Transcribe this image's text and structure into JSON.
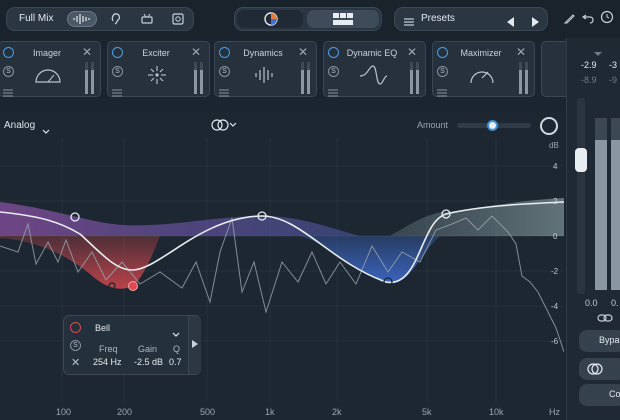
{
  "topbar": {
    "mix_label": "Full Mix",
    "presets_label": "Presets"
  },
  "modules": [
    {
      "name": "Imager",
      "icon": "imager-icon"
    },
    {
      "name": "Exciter",
      "icon": "exciter-icon"
    },
    {
      "name": "Dynamics",
      "icon": "dynamics-icon"
    },
    {
      "name": "Dynamic EQ",
      "icon": "dynamic-eq-icon"
    },
    {
      "name": "Maximizer",
      "icon": "maximizer-icon"
    }
  ],
  "module_solo_glyph": "S",
  "module_close_glyph": "✕",
  "eq": {
    "mode_label": "Analog",
    "amount_label": "Amount",
    "amount_value": 0.49,
    "db_label": "dB",
    "db_scale": [
      "4",
      "2",
      "0",
      "-2",
      "-4",
      "-6"
    ],
    "freq_ticks": [
      "100",
      "200",
      "500",
      "1k",
      "2k",
      "5k",
      "10k",
      "Hz"
    ]
  },
  "band": {
    "type": "Bell",
    "freq_label": "Freq",
    "gain_label": "Gain",
    "q_label": "Q",
    "freq_value": "254 Hz",
    "gain_value": "-2.5 dB",
    "q_value": "0.7"
  },
  "right_panel": {
    "peak_left": "-2.9",
    "peak_right": "-3",
    "rms_left": "-8.9",
    "rms_right": "-9",
    "bottom_left": "0.0",
    "bottom_right": "0.",
    "bypass_label": "Bypa",
    "compare_label": "Co"
  },
  "colors": {
    "accent": "#3f8ed4",
    "cut": "#e0494f",
    "boost_purple": "#7a5bb0",
    "dynamic_blue": "#3f6fd6",
    "curve": "#e8ecf0"
  }
}
